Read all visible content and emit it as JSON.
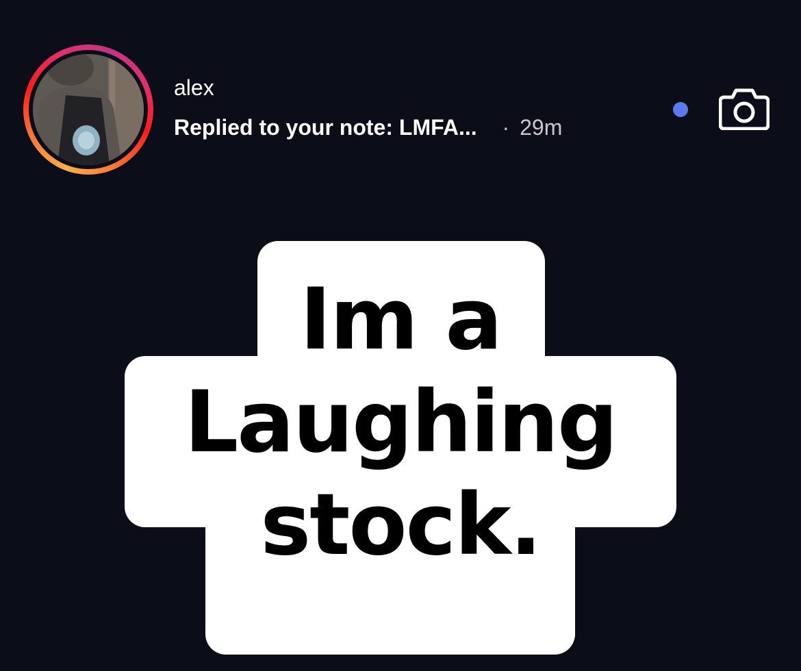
{
  "notification": {
    "username": "alex",
    "reply_text": "Replied to your note: LMFA...",
    "separator": "·",
    "time_ago": "29m",
    "unread": true,
    "avatar_ring_colors": [
      "#fcaf45",
      "#f77737",
      "#fd1d1d",
      "#e1306c",
      "#c13584"
    ],
    "unread_dot_color": "#5b78ef",
    "camera_icon": "camera-icon"
  },
  "note": {
    "lines": [
      "Im a",
      "Laughing",
      "stock."
    ]
  },
  "colors": {
    "background": "#0b0d19",
    "text": "#ffffff",
    "muted": "#c7c8cf",
    "sticker_bg": "#ffffff",
    "sticker_text": "#000000"
  }
}
